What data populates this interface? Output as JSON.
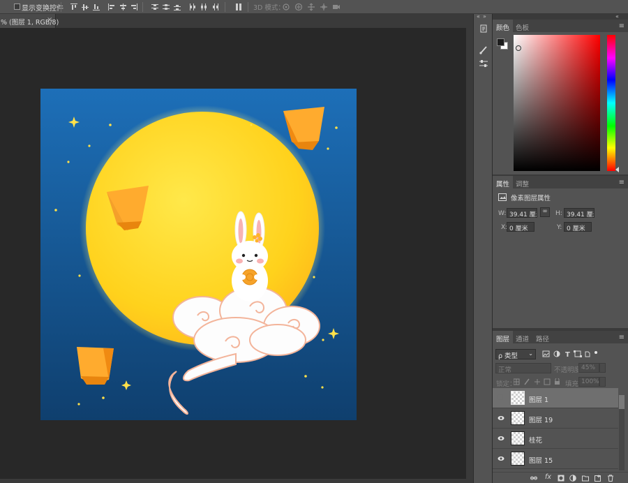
{
  "options_bar": {
    "show_transform_controls_label": "显示变换控件",
    "mode_3d_label": "3D 模式："
  },
  "document_tab": {
    "title": "% (图层 1, RGB/8)",
    "close_label": "×"
  },
  "color_panel": {
    "tabs": [
      "颜色",
      "色板"
    ],
    "foreground_color": "#1e1e1e",
    "background_color": "#ffffff",
    "hue_color": "#ff0000"
  },
  "properties_panel": {
    "tabs": [
      "属性",
      "调整"
    ],
    "header": "像素图层属性",
    "w_label": "W:",
    "w_value": "39.41 厘米",
    "h_label": "H:",
    "h_value": "39.41 厘米",
    "x_label": "X:",
    "x_value": "0 厘米",
    "y_label": "Y:",
    "y_value": "0 厘米",
    "link_icon": "link-icon"
  },
  "layers_panel": {
    "tabs": [
      "图层",
      "通道",
      "路径"
    ],
    "kind_filter": "ρ 类型",
    "blend_mode": "正常",
    "opacity_label": "不透明度：",
    "opacity_value": "45%",
    "lock_label": "锁定：",
    "fill_label": "填充：",
    "fill_value": "100%",
    "layers": [
      {
        "name": "图层 1",
        "visible": false,
        "selected": true
      },
      {
        "name": "图层 19",
        "visible": true,
        "selected": false
      },
      {
        "name": "桂花",
        "visible": true,
        "selected": false
      },
      {
        "name": "图层 15",
        "visible": true,
        "selected": false
      }
    ],
    "footer_fx": "fx"
  },
  "artwork": {
    "sky_top": "#1d6fb8",
    "sky_bottom": "#0f3f6e",
    "moon_color": "#ffd21c",
    "lantern_color": "#ffab2e"
  }
}
